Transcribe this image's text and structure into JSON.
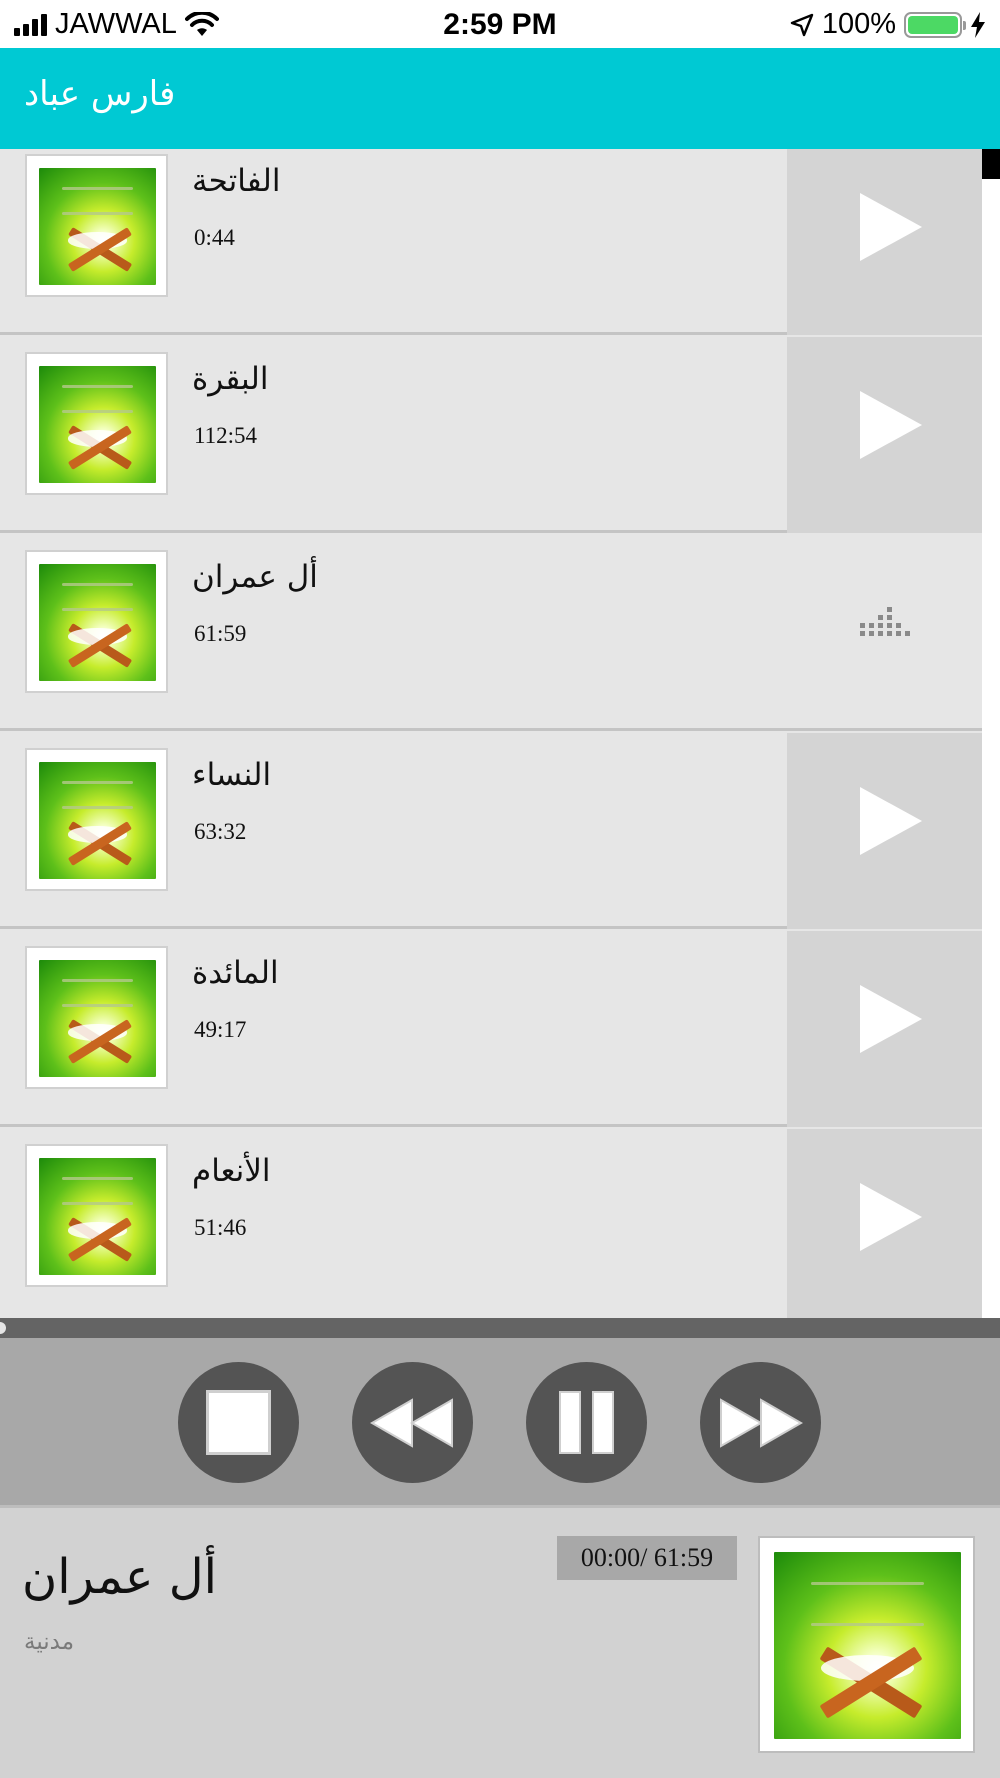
{
  "status_bar": {
    "carrier": "JAWWAL",
    "time": "2:59 PM",
    "battery": "100%",
    "icons": [
      "signal-icon",
      "wifi-icon",
      "location-icon",
      "battery-icon",
      "charging-icon"
    ]
  },
  "header": {
    "title": "فارس عباد",
    "color": "#00c9d3"
  },
  "tracks": [
    {
      "name": "الفاتحة",
      "duration": "0:44",
      "state": "play"
    },
    {
      "name": "البقرة",
      "duration": "112:54",
      "state": "play"
    },
    {
      "name": "أل عمران",
      "duration": "61:59",
      "state": "playing"
    },
    {
      "name": "النساء",
      "duration": "63:32",
      "state": "play"
    },
    {
      "name": "المائدة",
      "duration": "49:17",
      "state": "play"
    },
    {
      "name": "الأنعام",
      "duration": "51:46",
      "state": "play"
    }
  ],
  "controls": {
    "buttons": [
      "stop-icon",
      "rewind-icon",
      "pause-icon",
      "fast-forward-icon"
    ],
    "seek_progress": 0
  },
  "now_playing": {
    "title": "أل عمران",
    "subtitle": "مدنية",
    "time": "00:00/ 61:59"
  }
}
